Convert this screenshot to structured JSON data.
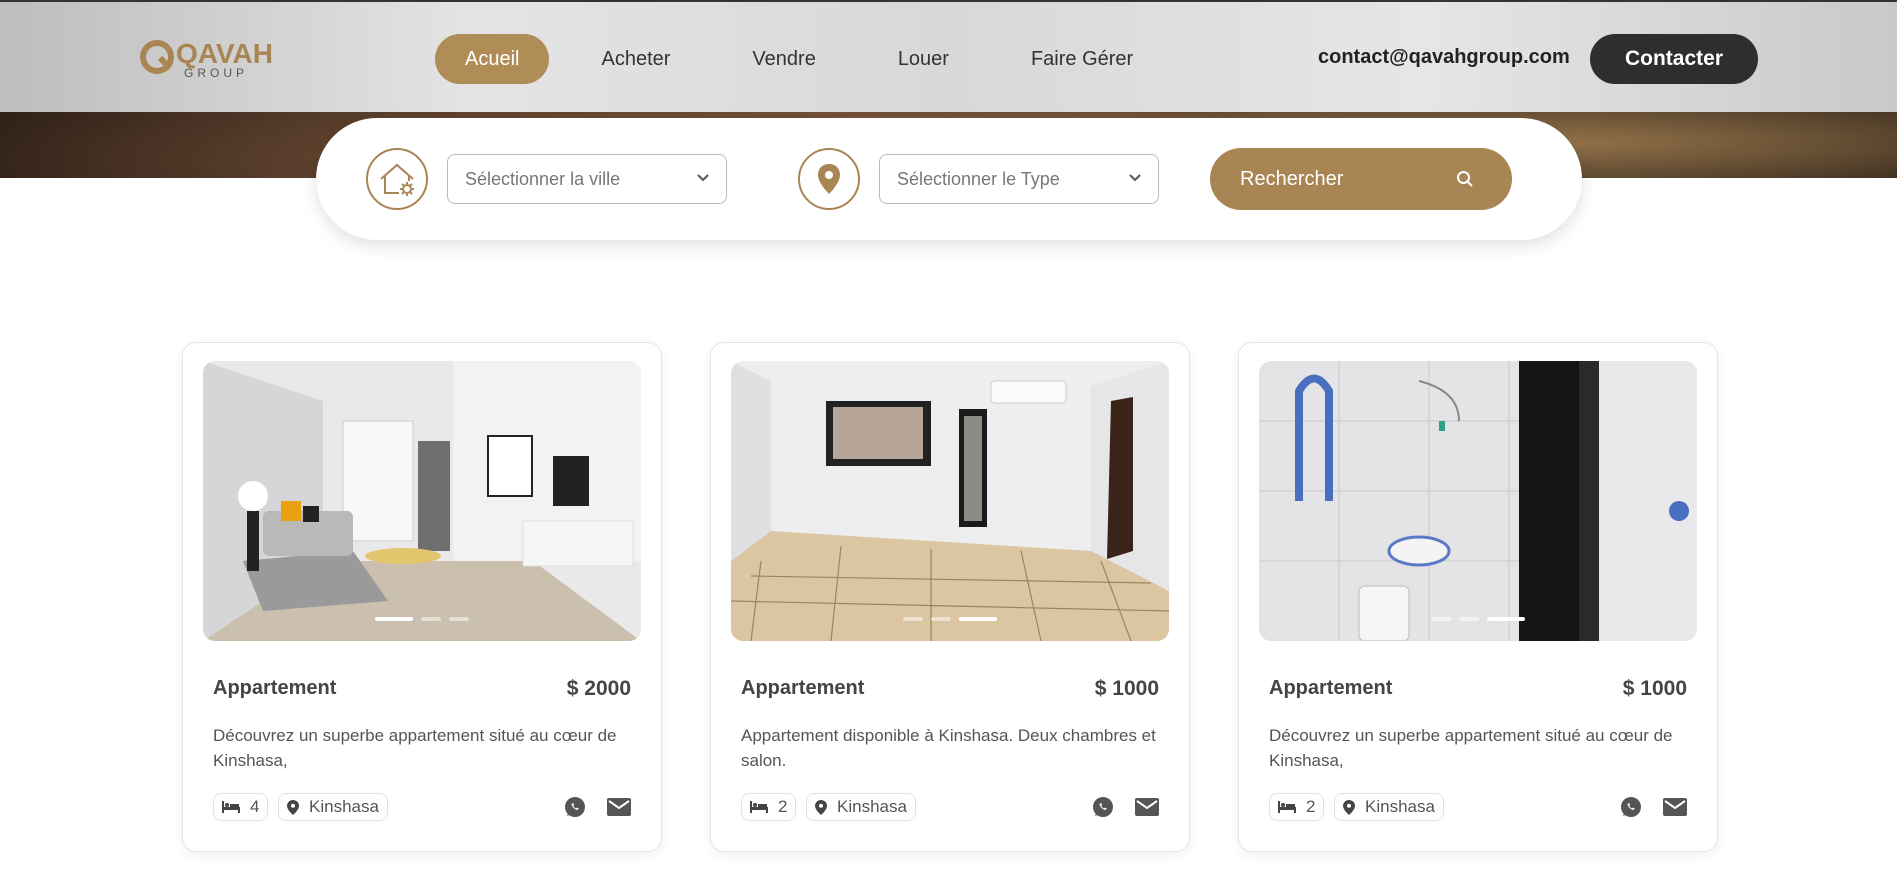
{
  "brand": {
    "logo_text": "QAVAH",
    "logo_sub": "GROUP",
    "accent": "#a88552"
  },
  "nav": {
    "items": [
      {
        "label": "Acueil",
        "active": true
      },
      {
        "label": "Acheter"
      },
      {
        "label": "Vendre"
      },
      {
        "label": "Louer"
      },
      {
        "label": "Faire Gérer"
      }
    ]
  },
  "header": {
    "email": "contact@qavahgroup.com",
    "contact_label": "Contacter"
  },
  "search": {
    "city_placeholder": "Sélectionner la ville",
    "type_placeholder": "Sélectionner le Type",
    "button_label": "Rechercher"
  },
  "listings": [
    {
      "title": "Appartement",
      "price": "$ 2000",
      "description": "Découvrez un superbe appartement situé au cœur de Kinshasa,",
      "rooms": "4",
      "city": "Kinshasa",
      "slide": 1
    },
    {
      "title": "Appartement",
      "price": "$ 1000",
      "description": "Appartement disponible à Kinshasa. Deux chambres et salon.",
      "rooms": "2",
      "city": "Kinshasa",
      "slide": 3
    },
    {
      "title": "Appartement",
      "price": "$ 1000",
      "description": "Découvrez un superbe appartement situé au cœur de Kinshasa,",
      "rooms": "2",
      "city": "Kinshasa",
      "slide": 3
    }
  ]
}
